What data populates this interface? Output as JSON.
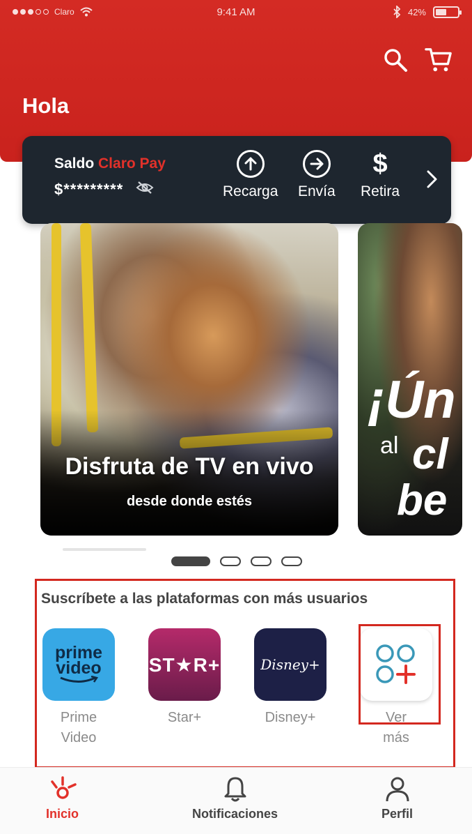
{
  "status_bar": {
    "carrier": "Claro",
    "time": "9:41 AM",
    "battery": "42%"
  },
  "header": {
    "greeting": "Hola"
  },
  "wallet": {
    "title_prefix": "Saldo ",
    "title_brand": "Claro Pay",
    "balance_masked": "$*********",
    "actions": [
      {
        "label": "Recarga",
        "icon": "arrow-up-circle-icon"
      },
      {
        "label": "Envía",
        "icon": "arrow-right-circle-icon"
      },
      {
        "label": "Retira",
        "icon": "dollar-icon"
      }
    ]
  },
  "banners": [
    {
      "title": "Disfruta de TV en vivo",
      "subtitle": "desde donde estés"
    },
    {
      "line1": "¡Ún",
      "line2_small": "al",
      "line2_big": "cl",
      "line3": "be"
    }
  ],
  "pager": {
    "count": 4,
    "active_index": 0
  },
  "platforms": {
    "title": "Suscríbete a las plataformas con más usuarios",
    "items": [
      {
        "label": "Prime Video",
        "logo_line1": "prime",
        "logo_line2": "video"
      },
      {
        "label": "Star+",
        "logo": "ST★R+"
      },
      {
        "label": "Disney+",
        "logo": "Disney+"
      },
      {
        "label": "Ver más"
      }
    ]
  },
  "bottom_nav": {
    "items": [
      {
        "label": "Inicio",
        "icon": "home-burst-icon",
        "active": true
      },
      {
        "label": "Notificaciones",
        "icon": "bell-icon",
        "active": false
      },
      {
        "label": "Perfil",
        "icon": "user-icon",
        "active": false
      }
    ]
  },
  "colors": {
    "brand_red": "#d42b24",
    "wallet_bg": "#1e262f",
    "highlight_red": "#d3281f"
  }
}
